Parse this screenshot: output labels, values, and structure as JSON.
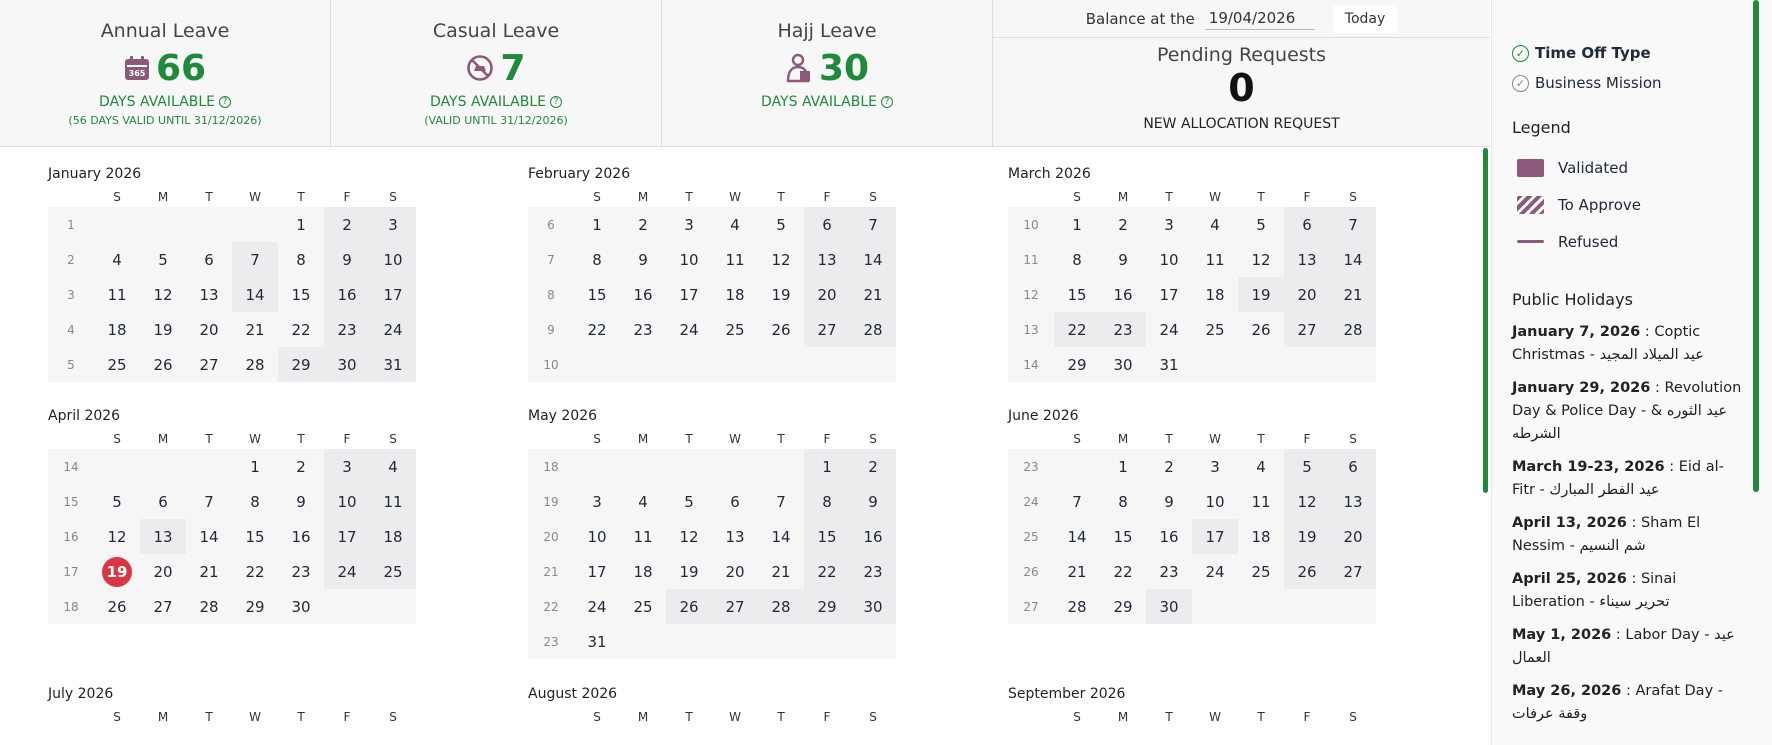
{
  "stats": {
    "annual": {
      "title": "Annual Leave",
      "value": "66",
      "avail": "DAYS AVAILABLE",
      "valid": "(56 DAYS VALID UNTIL 31/12/2026)"
    },
    "casual": {
      "title": "Casual Leave",
      "value": "7",
      "avail": "DAYS AVAILABLE",
      "valid": "(VALID UNTIL 31/12/2026)"
    },
    "hajj": {
      "title": "Hajj Leave",
      "value": "30",
      "avail": "DAYS AVAILABLE"
    },
    "help_mark": "?",
    "balance_label": "Balance at the",
    "balance_date": "19/04/2026",
    "today_label": "Today",
    "pending_title": "Pending Requests",
    "pending_value": "0",
    "new_alloc": "NEW ALLOCATION REQUEST"
  },
  "calendar": {
    "dow": [
      "S",
      "M",
      "T",
      "W",
      "T",
      "F",
      "S"
    ],
    "months": [
      {
        "name": "January 2026",
        "weeks": [
          [
            1,
            null,
            null,
            null,
            null,
            1,
            2,
            3
          ],
          [
            2,
            4,
            5,
            6,
            7,
            8,
            9,
            10
          ],
          [
            3,
            11,
            12,
            13,
            14,
            15,
            16,
            17
          ],
          [
            4,
            18,
            19,
            20,
            21,
            22,
            23,
            24
          ],
          [
            5,
            25,
            26,
            27,
            28,
            29,
            30,
            31
          ]
        ],
        "hol": [
          7,
          14,
          29
        ]
      },
      {
        "name": "February 2026",
        "weeks": [
          [
            6,
            1,
            2,
            3,
            4,
            5,
            6,
            7
          ],
          [
            7,
            8,
            9,
            10,
            11,
            12,
            13,
            14
          ],
          [
            8,
            15,
            16,
            17,
            18,
            19,
            20,
            21
          ],
          [
            9,
            22,
            23,
            24,
            25,
            26,
            27,
            28
          ],
          [
            10,
            null,
            null,
            null,
            null,
            null,
            null,
            null
          ]
        ],
        "hol": []
      },
      {
        "name": "March 2026",
        "weeks": [
          [
            10,
            1,
            2,
            3,
            4,
            5,
            6,
            7
          ],
          [
            11,
            8,
            9,
            10,
            11,
            12,
            13,
            14
          ],
          [
            12,
            15,
            16,
            17,
            18,
            19,
            20,
            21
          ],
          [
            13,
            22,
            23,
            24,
            25,
            26,
            27,
            28
          ],
          [
            14,
            29,
            30,
            31,
            null,
            null,
            null,
            null
          ]
        ],
        "hol": [
          19,
          22,
          23
        ]
      },
      {
        "name": "April 2026",
        "weeks": [
          [
            14,
            null,
            null,
            null,
            1,
            2,
            3,
            4
          ],
          [
            15,
            5,
            6,
            7,
            8,
            9,
            10,
            11
          ],
          [
            16,
            12,
            13,
            14,
            15,
            16,
            17,
            18
          ],
          [
            17,
            19,
            20,
            21,
            22,
            23,
            24,
            25
          ],
          [
            18,
            26,
            27,
            28,
            29,
            30,
            null,
            null
          ]
        ],
        "hol": [
          13,
          25
        ],
        "today": 19
      },
      {
        "name": "May 2026",
        "weeks": [
          [
            18,
            null,
            null,
            null,
            null,
            null,
            1,
            2
          ],
          [
            19,
            3,
            4,
            5,
            6,
            7,
            8,
            9
          ],
          [
            20,
            10,
            11,
            12,
            13,
            14,
            15,
            16
          ],
          [
            21,
            17,
            18,
            19,
            20,
            21,
            22,
            23
          ],
          [
            22,
            24,
            25,
            26,
            27,
            28,
            29,
            30
          ],
          [
            23,
            31,
            null,
            null,
            null,
            null,
            null,
            null
          ]
        ],
        "hol": [
          26,
          27,
          28
        ]
      },
      {
        "name": "June 2026",
        "weeks": [
          [
            23,
            null,
            1,
            2,
            3,
            4,
            5,
            6
          ],
          [
            24,
            7,
            8,
            9,
            10,
            11,
            12,
            13
          ],
          [
            25,
            14,
            15,
            16,
            17,
            18,
            19,
            20
          ],
          [
            26,
            21,
            22,
            23,
            24,
            25,
            26,
            27
          ],
          [
            27,
            28,
            29,
            30,
            null,
            null,
            null,
            null
          ]
        ],
        "hol": [
          17,
          30
        ]
      },
      {
        "name": "July 2026",
        "weeks": [],
        "hol": []
      },
      {
        "name": "August 2026",
        "weeks": [],
        "hol": []
      },
      {
        "name": "September 2026",
        "weeks": [],
        "hol": []
      }
    ]
  },
  "sidebar": {
    "types": [
      "Time Off Type",
      "Business Mission"
    ],
    "legend_title": "Legend",
    "legend": [
      "Validated",
      "To Approve",
      "Refused"
    ],
    "holidays_title": "Public Holidays",
    "holidays": [
      {
        "date": "January 7, 2026",
        "name": " : Coptic Christmas - عيد الميلاد المجيد"
      },
      {
        "date": "January 29, 2026",
        "name": " : Revolution Day & Police Day - عيد الثوره & الشرطه"
      },
      {
        "date": "March 19-23, 2026",
        "name": " : Eid al-Fitr - عيد الفطر المبارك"
      },
      {
        "date": "April 13, 2026",
        "name": " : Sham El Nessim - شم النسيم"
      },
      {
        "date": "April 25, 2026",
        "name": " : Sinai Liberation - تحرير سيناء"
      },
      {
        "date": "May 1, 2026",
        "name": " : Labor Day - عيد العمال"
      },
      {
        "date": "May 26, 2026",
        "name": " : Arafat Day - وقفة عرفات"
      }
    ]
  },
  "colors": {
    "accent": "#1f8a3b",
    "today": "#dc3545",
    "validated": "#8b5a7a"
  }
}
